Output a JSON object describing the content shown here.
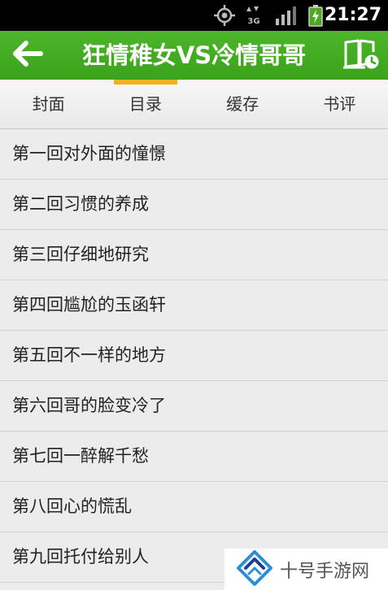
{
  "status_bar": {
    "time": "21:27",
    "icons": [
      "gps-icon",
      "signal-3g-icon",
      "signal-bars-icon",
      "battery-charging-icon"
    ],
    "network_label": "3G"
  },
  "header": {
    "title": "狂情稚女VS冷情哥哥",
    "back_icon": "back-arrow-icon",
    "shelf_icon": "bookshelf-clock-icon",
    "background_color": "#42ac22"
  },
  "tabs": [
    {
      "label": "封面",
      "active": false
    },
    {
      "label": "目录",
      "active": true
    },
    {
      "label": "缓存",
      "active": false
    },
    {
      "label": "书评",
      "active": false
    }
  ],
  "tab_indicator_color": "#f3b21a",
  "chapters": [
    "第一回对外面的憧憬",
    "第二回习惯的养成",
    "第三回仔细地研究",
    "第四回尴尬的玉函轩",
    "第五回不一样的地方",
    "第六回哥的脸变冷了",
    "第七回一醉解千愁",
    "第八回心的慌乱",
    "第九回托付给别人"
  ],
  "watermark": {
    "text": "十号手游网",
    "logo_icon": "shihao-logo-icon"
  }
}
